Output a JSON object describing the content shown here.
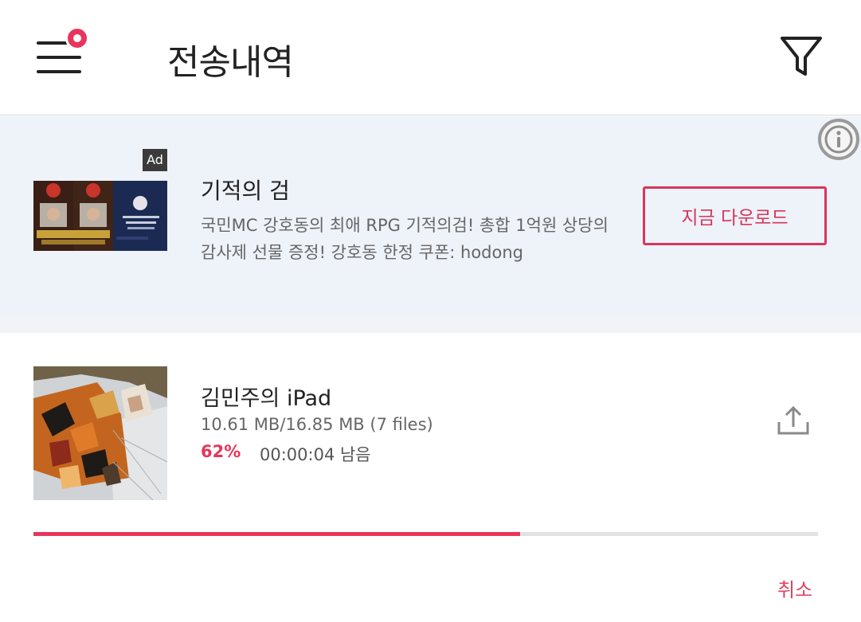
{
  "header": {
    "title": "전송내역",
    "menu_icon": "hamburger-menu-icon",
    "filter_icon": "filter-icon"
  },
  "ad": {
    "badge": "Ad",
    "title": "기적의 검",
    "description_line1": "국민MC 강호동의 최애 RPG 기적의검! 총합 1억원 상당의",
    "description_line2": "감사제 선물 증정! 강호동 한정 쿠폰: hodong",
    "cta_label": "지금 다운로드",
    "info_icon": "info-icon"
  },
  "transfer": {
    "device_name": "김민주의 iPad",
    "size_text": "10.61 MB/16.85 MB (7 files)",
    "percent_label": "62%",
    "progress_fraction": 0.62,
    "remaining_text": "00:00:04 남음",
    "share_icon": "upload-icon",
    "cancel_label": "취소"
  },
  "colors": {
    "accent": "#e8355b",
    "ad_background": "#eef2f9",
    "track": "#e2e2e2"
  }
}
